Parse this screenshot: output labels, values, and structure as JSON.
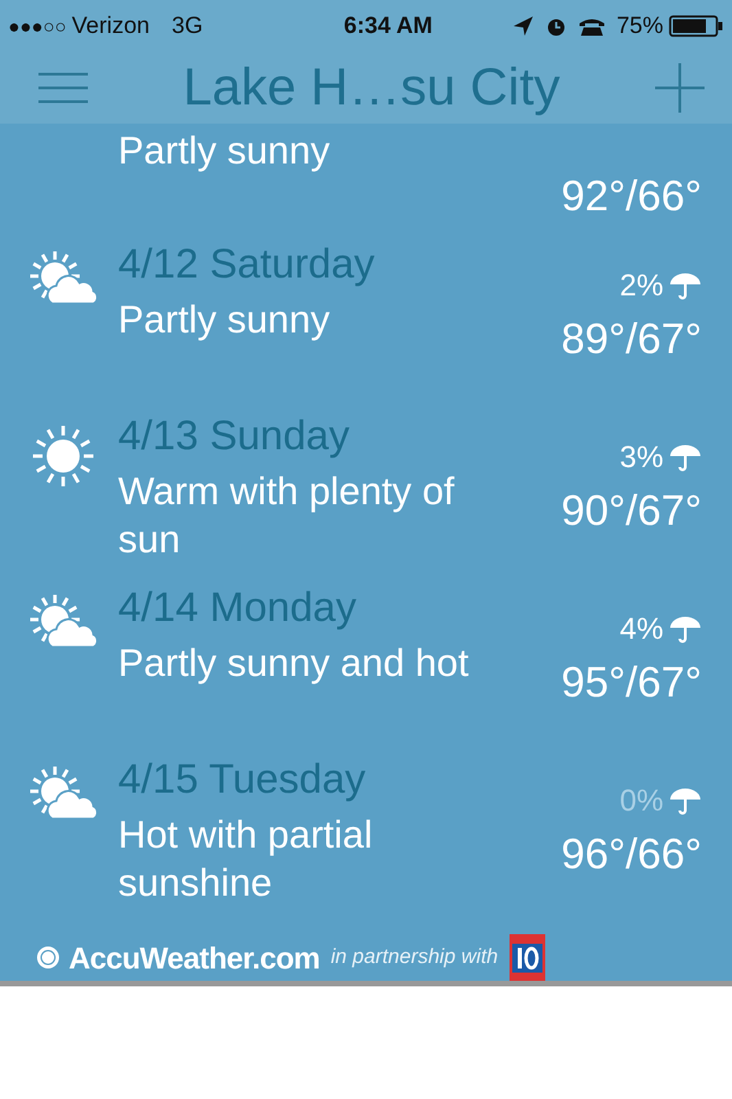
{
  "status_bar": {
    "signal": "●●●○○",
    "carrier": "Verizon",
    "network": "3G",
    "time": "6:34 AM",
    "battery": "75%"
  },
  "header": {
    "title": "Lake H…su City"
  },
  "days": [
    {
      "kind": "partial",
      "description": "Partly sunny",
      "temps": "92°/66°"
    },
    {
      "kind": "partly_cloudy",
      "date": "4/12 Saturday",
      "description": "Partly sunny",
      "precip": "2%",
      "dim": false,
      "temps": "89°/67°"
    },
    {
      "kind": "sunny",
      "date": "4/13 Sunday",
      "description": "Warm with plenty of sun",
      "precip": "3%",
      "dim": false,
      "temps": "90°/67°"
    },
    {
      "kind": "partly_cloudy",
      "date": "4/14 Monday",
      "description": "Partly sunny and hot",
      "precip": "4%",
      "dim": false,
      "temps": "95°/67°"
    },
    {
      "kind": "partly_cloudy",
      "date": "4/15 Tuesday",
      "description": "Hot with partial sunshine",
      "precip": "0%",
      "dim": true,
      "temps": "96°/66°"
    }
  ],
  "footer": {
    "brand": "AccuWeather.com",
    "partner": "in partnership with"
  }
}
